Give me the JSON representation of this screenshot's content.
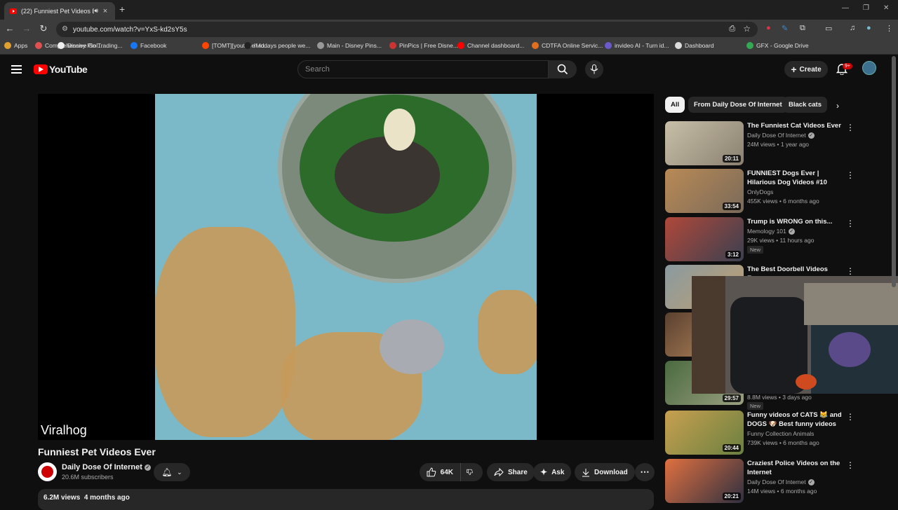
{
  "browser": {
    "tab_title": "(22) Funniest Pet Videos Ev",
    "url": "youtube.com/watch?v=YxS-kd2sY5s",
    "bookmarks": [
      {
        "label": "Apps",
        "color": "#e0a030"
      },
      {
        "label": "Comprehensive Gol...",
        "color": "#e05050"
      },
      {
        "label": "Disney Pin Trading...",
        "color": "#eeeeee"
      },
      {
        "label": "Facebook",
        "color": "#1877f2"
      },
      {
        "label": "[TOMT][youtube vid...",
        "color": "#ff4500"
      },
      {
        "label": "If todays people we...",
        "color": "#222222"
      },
      {
        "label": "Main - Disney Pins...",
        "color": "#999999"
      },
      {
        "label": "PinPics | Free Disne...",
        "color": "#cc3333"
      },
      {
        "label": "Channel dashboard...",
        "color": "#ff0000"
      },
      {
        "label": "CDTFA Online Servic...",
        "color": "#e07020"
      },
      {
        "label": "invideo AI - Turn id...",
        "color": "#6a5acd"
      },
      {
        "label": "Dashboard",
        "color": "#dddddd"
      },
      {
        "label": "GFX - Google Drive",
        "color": "#34a853"
      }
    ]
  },
  "masthead": {
    "logo_text": "YouTube",
    "search_placeholder": "Search",
    "create_label": "Create",
    "notifications": "9+"
  },
  "video": {
    "watermark": "Viralhog",
    "title": "Funniest Pet Videos Ever",
    "channel": "Daily Dose Of Internet",
    "subscribers": "20.6M subscribers",
    "likes": "64K",
    "share_label": "Share",
    "ask_label": "Ask",
    "download_label": "Download",
    "views": "6.2M views",
    "age": "4 months ago"
  },
  "chips": [
    "All",
    "From Daily Dose Of Internet",
    "Black cats"
  ],
  "recommendations": [
    {
      "title": "The Funniest Cat Videos Ever",
      "channel": "Daily Dose Of Internet",
      "verified": true,
      "meta": "24M views • 1 year ago",
      "duration": "20:11",
      "new": false,
      "colors": [
        "#c8bfa8",
        "#8a8070"
      ]
    },
    {
      "title": "FUNNIEST Dogs Ever | Hilarious Dog Videos #10",
      "channel": "OnlyDogs",
      "verified": false,
      "meta": "455K views • 6 months ago",
      "duration": "33:54",
      "new": false,
      "colors": [
        "#b98a55",
        "#7a6a5a"
      ]
    },
    {
      "title": "Trump is WRONG on this...",
      "channel": "Memology 101",
      "verified": true,
      "meta": "29K views • 11 hours ago",
      "duration": "3:12",
      "new": true,
      "new_label": "New",
      "colors": [
        "#b0483a",
        "#3a4050"
      ]
    },
    {
      "title": "The Best Doorbell Videos Ever",
      "channel": "",
      "verified": false,
      "meta": "",
      "duration": "",
      "new": false,
      "colors": [
        "#8a9aa0",
        "#c0a070"
      ]
    },
    {
      "title": "",
      "channel": "",
      "verified": false,
      "meta": "",
      "duration": "",
      "new": false,
      "colors": [
        "#5a4030",
        "#c09060"
      ]
    },
    {
      "title": "",
      "channel": "",
      "verified": false,
      "meta": "8.8M views • 3 days ago",
      "duration": "29:57",
      "new": true,
      "new_label": "New",
      "colors": [
        "#4a6a40",
        "#9aa080"
      ]
    },
    {
      "title": "Funny videos of CATS 😹 and DOGS 🐶 Best funny videos of ...",
      "channel": "Funny Collection Animals",
      "verified": false,
      "meta": "739K views • 6 months ago",
      "duration": "20:44",
      "new": false,
      "colors": [
        "#c8a050",
        "#6a8040"
      ]
    },
    {
      "title": "Craziest Police Videos on the Internet",
      "channel": "Daily Dose Of Internet",
      "verified": true,
      "meta": "14M views • 6 months ago",
      "duration": "20:21",
      "new": false,
      "colors": [
        "#e07040",
        "#303040"
      ]
    }
  ]
}
